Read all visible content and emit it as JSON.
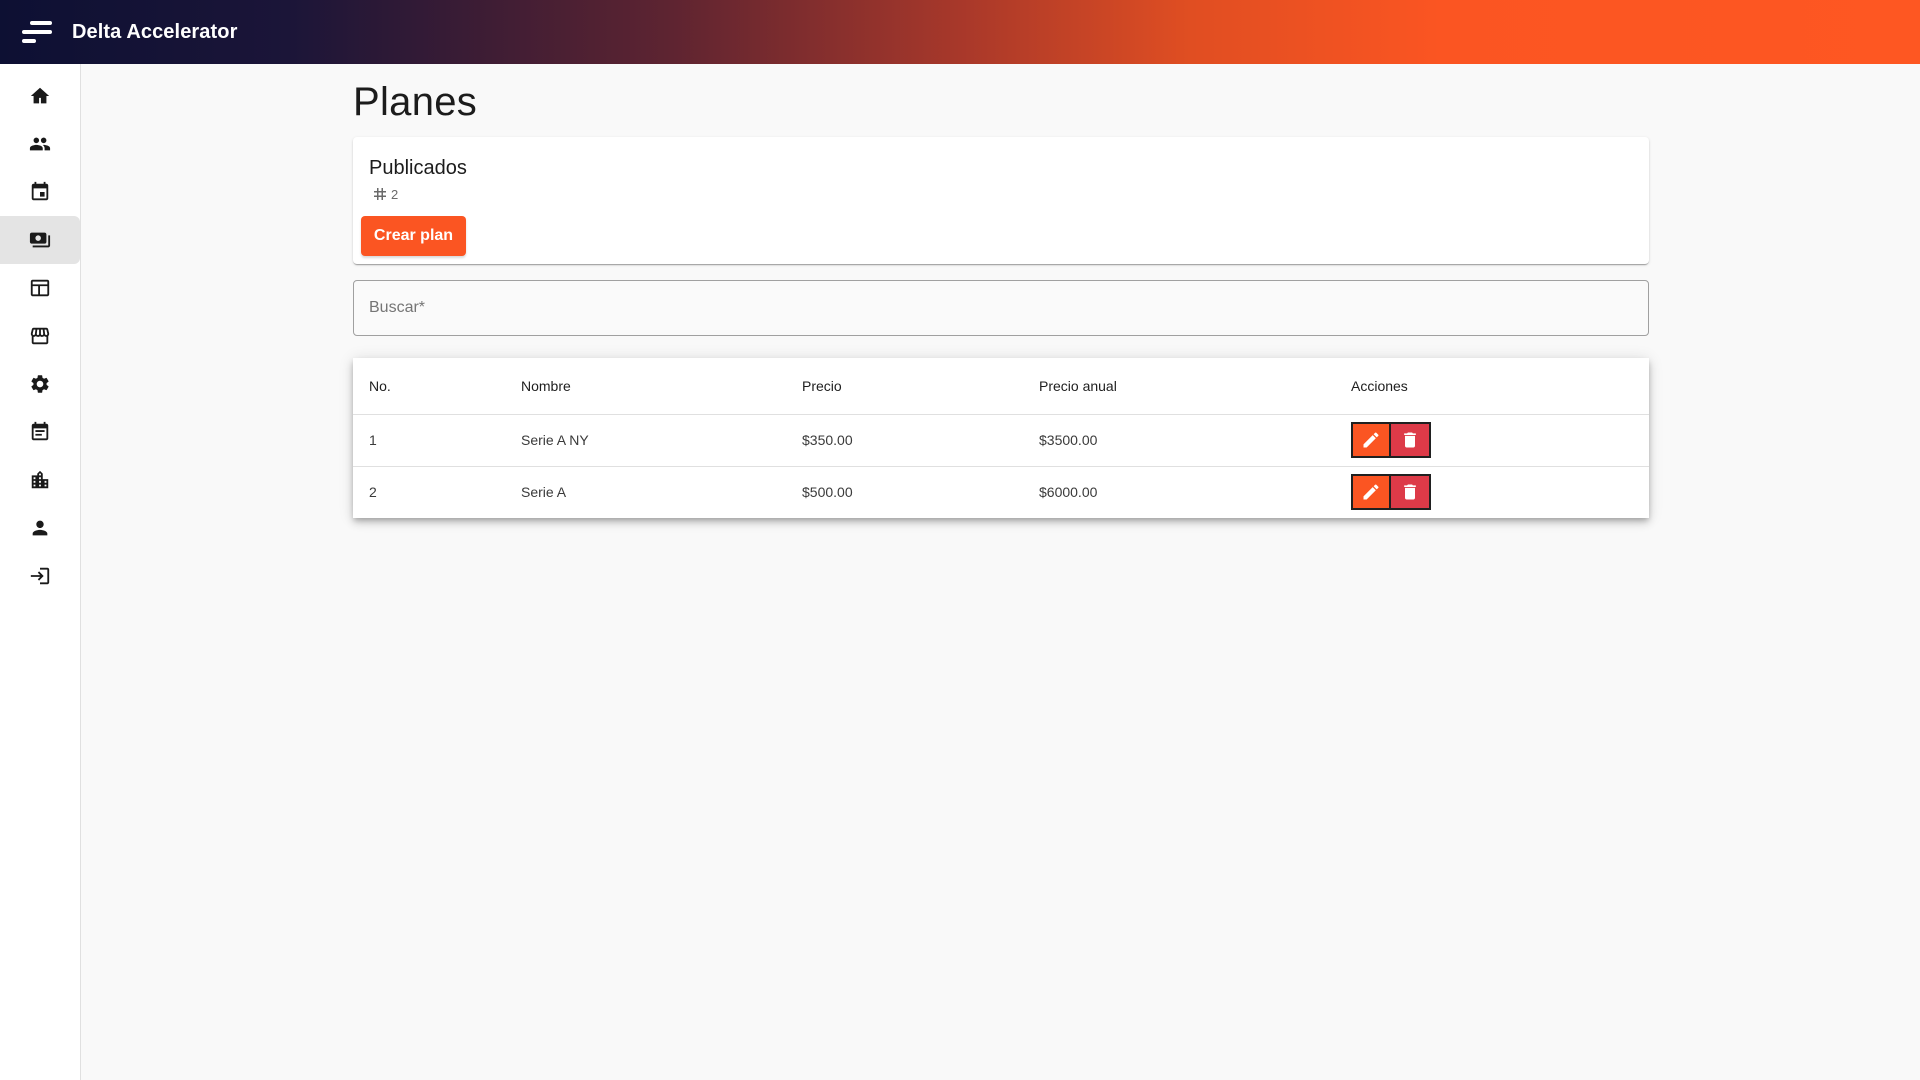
{
  "header": {
    "app_title": "Delta Accelerator",
    "menu_icon": "menu-icon",
    "gradient_colors": [
      "#0d1033",
      "#5e2431",
      "#fb5522"
    ]
  },
  "sidebar": {
    "items": [
      {
        "icon": "home-icon",
        "active": false
      },
      {
        "icon": "people-icon",
        "active": false
      },
      {
        "icon": "calendar-event-icon",
        "active": false
      },
      {
        "icon": "payments-icon",
        "active": true
      },
      {
        "icon": "table-icon",
        "active": false
      },
      {
        "icon": "store-icon",
        "active": false
      },
      {
        "icon": "settings-icon",
        "active": false
      },
      {
        "icon": "event-note-icon",
        "active": false
      },
      {
        "icon": "business-icon",
        "active": false
      },
      {
        "icon": "person-icon",
        "active": false
      },
      {
        "icon": "login-icon",
        "active": false
      }
    ]
  },
  "page": {
    "title": "Planes"
  },
  "summary_card": {
    "title": "Publicados",
    "count": "2",
    "count_icon": "hash-icon",
    "create_button_label": "Crear plan"
  },
  "search": {
    "placeholder": "Buscar*",
    "value": ""
  },
  "table": {
    "columns": [
      "No.",
      "Nombre",
      "Precio",
      "Precio anual",
      "Acciones"
    ],
    "rows": [
      {
        "no": "1",
        "nombre": "Serie A NY",
        "precio": "$350.00",
        "precio_anual": "$3500.00"
      },
      {
        "no": "2",
        "nombre": "Serie A",
        "precio": "$500.00",
        "precio_anual": "$6000.00"
      }
    ]
  },
  "colors": {
    "accent": "#fb5522",
    "delete": "#dd3a48"
  }
}
